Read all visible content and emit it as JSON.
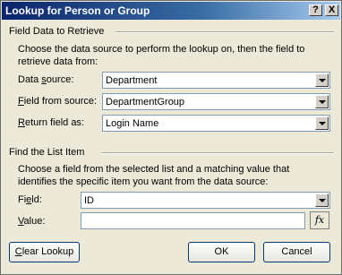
{
  "dialog": {
    "title": "Lookup for Person or Group",
    "help_glyph": "?",
    "close_glyph": "X"
  },
  "field_data_section": {
    "title": "Field Data to Retrieve",
    "description": "Choose the data source to perform the lookup on, then the field to retrieve data from:",
    "data_source": {
      "label_pre": "Data ",
      "label_key": "s",
      "label_post": "ource:",
      "value": "Department"
    },
    "field_from_source": {
      "label_key": "F",
      "label_post": "ield from source:",
      "value": "DepartmentGroup"
    },
    "return_field": {
      "label_key": "R",
      "label_post": "eturn field as:",
      "value": "Login Name"
    }
  },
  "find_section": {
    "title": "Find the List Item",
    "description": "Choose a field from the selected list and a matching value that identifies the specific item you want from the data source:",
    "field": {
      "label_pre": "Fi",
      "label_key": "e",
      "label_post": "ld:",
      "value": "ID"
    },
    "value": {
      "label_key": "V",
      "label_post": "alue:",
      "value": ""
    },
    "fx_label": "fx"
  },
  "buttons": {
    "clear_key": "C",
    "clear_post": "lear Lookup",
    "ok": "OK",
    "cancel": "Cancel"
  }
}
